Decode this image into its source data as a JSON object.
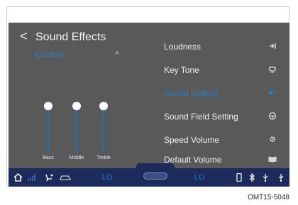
{
  "header": {
    "back_icon": "chevron-left",
    "title": "Sound Effects",
    "preset_value": "Custom",
    "expand_icon": "chevron-up"
  },
  "equalizer": {
    "sliders": [
      {
        "label": "Bass"
      },
      {
        "label": "Middle"
      },
      {
        "label": "Treble"
      }
    ]
  },
  "menu": {
    "items": [
      {
        "label": "Loudness",
        "icon": "loudness-icon",
        "active": false
      },
      {
        "label": "Key Tone",
        "icon": "key-tone-icon",
        "active": false
      },
      {
        "label": "Sound Setting",
        "icon": "speaker-icon",
        "active": true
      },
      {
        "label": "Sound Field Setting",
        "icon": "sound-field-icon",
        "active": false
      },
      {
        "label": "Speed Volume",
        "icon": "gear-icon",
        "active": false
      },
      {
        "label": "Default Volume",
        "icon": "book-icon",
        "active": false
      }
    ]
  },
  "statusbar": {
    "left_temp": "LO",
    "right_temp": "LO"
  },
  "caption": "OMT15-5048",
  "colors": {
    "screen_bg": "#595959",
    "accent": "#2a7fc4",
    "statusbar_bg": "#1c2a5c"
  }
}
